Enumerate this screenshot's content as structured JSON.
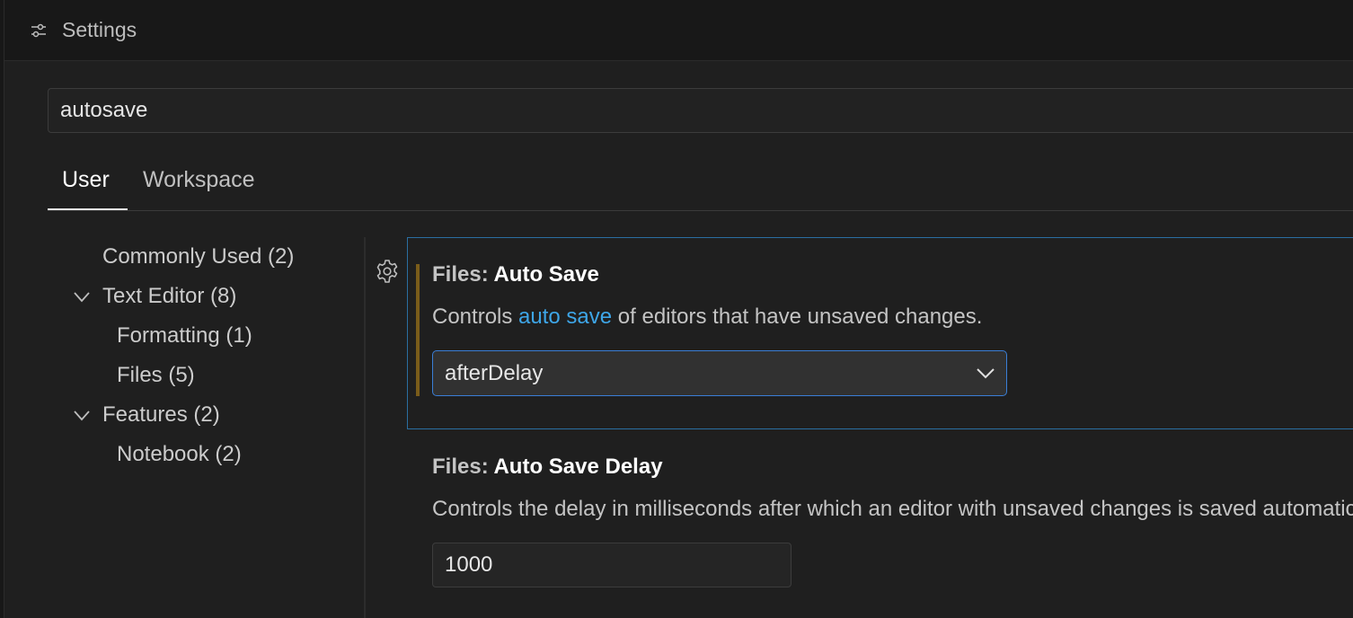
{
  "window": {
    "title": "Settings",
    "icon": "settings-sliders-icon"
  },
  "search": {
    "value": "autosave"
  },
  "tabs": [
    {
      "label": "User",
      "active": true
    },
    {
      "label": "Workspace",
      "active": false
    }
  ],
  "toc": {
    "items": [
      {
        "label": "Commonly Used (2)",
        "expanded": null
      },
      {
        "label": "Text Editor (8)",
        "expanded": true
      },
      {
        "label": "Formatting (1)",
        "expanded": null
      },
      {
        "label": "Files (5)",
        "expanded": null
      },
      {
        "label": "Features (2)",
        "expanded": true
      },
      {
        "label": "Notebook (2)",
        "expanded": null
      }
    ]
  },
  "settings": [
    {
      "category": "Files: ",
      "name": "Auto Save",
      "description_before": "Controls ",
      "description_link": "auto save",
      "description_after": " of editors that have unsaved changes.",
      "control": "select",
      "value": "afterDelay",
      "modified": true,
      "focused": true
    },
    {
      "category": "Files: ",
      "name": "Auto Save Delay",
      "description": "Controls the delay in milliseconds after which an editor with unsaved changes is saved automatically.",
      "control": "number",
      "value": "1000",
      "modified": false,
      "focused": false
    }
  ],
  "colors": {
    "background": "#1f1f1f",
    "focus_border": "#2a6ea1",
    "modified_indicator": "#7a5c1a",
    "link": "#3ea6e8",
    "select_border": "#3a7ed6"
  }
}
